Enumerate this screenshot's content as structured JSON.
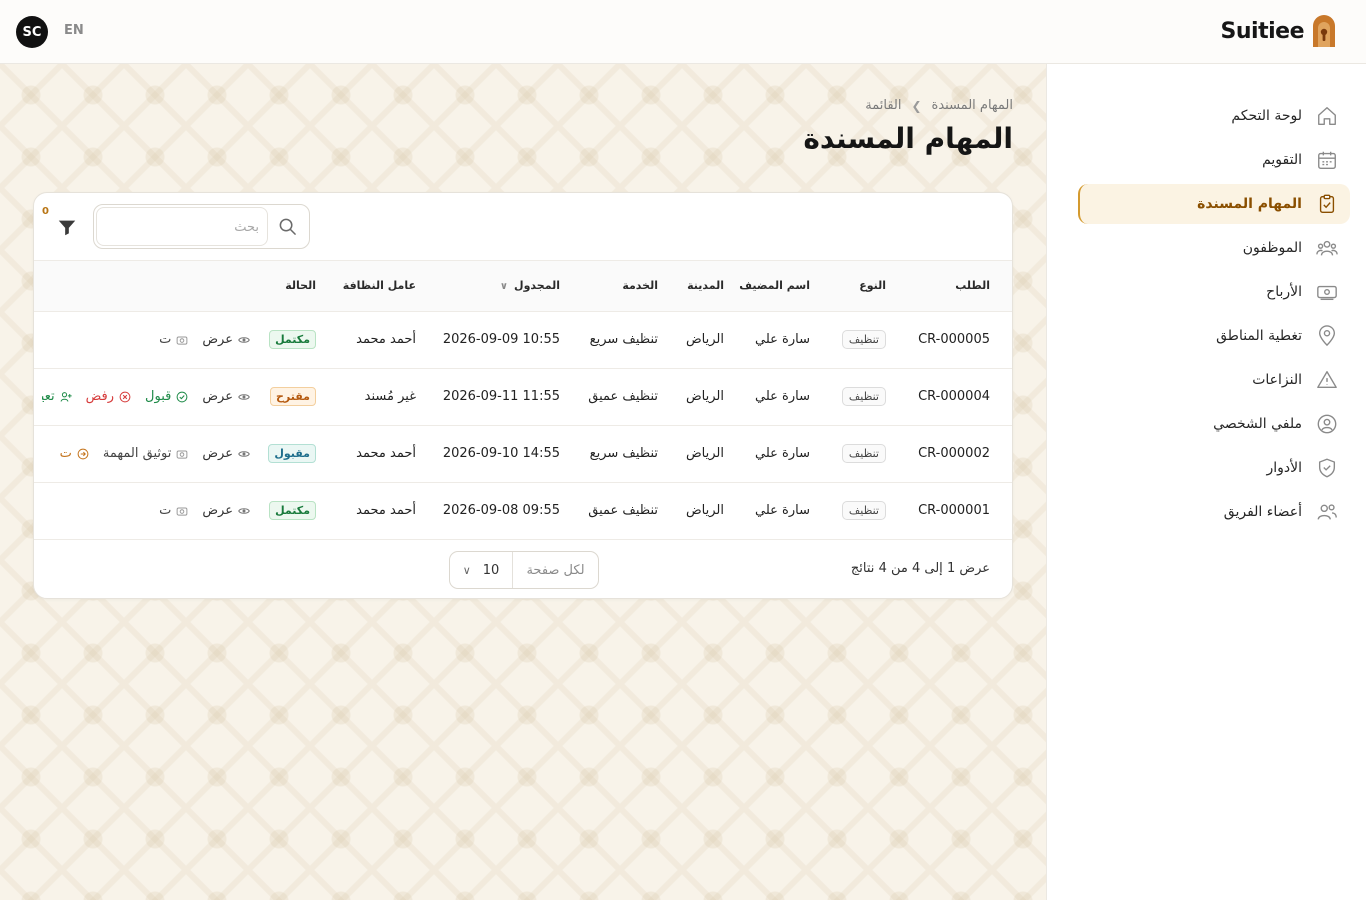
{
  "topbar": {
    "avatar_initials": "SC",
    "language": "EN",
    "brand_name": "Suitiee",
    "brand_color": "#c8782a"
  },
  "breadcrumb": {
    "parent": "المهام المسندة",
    "current": "القائمة"
  },
  "page": {
    "title": "المهام المسندة"
  },
  "toolbar": {
    "search_placeholder": "بحث",
    "filter_count": "0"
  },
  "table": {
    "headers": {
      "request": "الطلب",
      "type": "النوع",
      "guest_name": "اسم المضيف",
      "city": "المدينة",
      "service": "الخدمة",
      "scheduled": "المجدول",
      "cleaner": "عامل النظافة",
      "status": "الحالة"
    },
    "rows": [
      {
        "id": "CR-000005",
        "type": "تنظيف",
        "guest": "سارة علي",
        "city": "الرياض",
        "service": "تنظيف سريع",
        "scheduled": "2026-09-09 10:55",
        "cleaner": "أحمد محمد",
        "status": "مكتمل",
        "actions": {
          "view": "عرض",
          "extra": "ت"
        }
      },
      {
        "id": "CR-000004",
        "type": "تنظيف",
        "guest": "سارة علي",
        "city": "الرياض",
        "service": "تنظيف عميق",
        "scheduled": "2026-09-11 11:55",
        "cleaner": "غير مُسند",
        "status": "مقترح",
        "actions": {
          "view": "عرض",
          "accept": "قبول",
          "reject": "رفض",
          "assign": "تعيين"
        }
      },
      {
        "id": "CR-000002",
        "type": "تنظيف",
        "guest": "سارة علي",
        "city": "الرياض",
        "service": "تنظيف سريع",
        "scheduled": "2026-09-10 14:55",
        "cleaner": "أحمد محمد",
        "status": "مقبول",
        "actions": {
          "view": "عرض",
          "document": "توثيق المهمة",
          "extra": "ت"
        }
      },
      {
        "id": "CR-000001",
        "type": "تنظيف",
        "guest": "سارة علي",
        "city": "الرياض",
        "service": "تنظيف عميق",
        "scheduled": "2026-09-08 09:55",
        "cleaner": "أحمد محمد",
        "status": "مكتمل",
        "actions": {
          "view": "عرض",
          "extra": "ت"
        }
      }
    ]
  },
  "footer": {
    "summary": "عرض 1 إلى 4 من 4 نتائج",
    "per_page_label": "لكل صفحة",
    "per_page_value": "10"
  },
  "sidebar": {
    "items": [
      {
        "label": "لوحة التحكم",
        "icon": "home-icon"
      },
      {
        "label": "التقويم",
        "icon": "calendar-icon"
      },
      {
        "label": "المهام المسندة",
        "icon": "clipboard-check-icon",
        "active": true
      },
      {
        "label": "الموظفون",
        "icon": "users-icon"
      },
      {
        "label": "الأرباح",
        "icon": "banknote-icon"
      },
      {
        "label": "تغطية المناطق",
        "icon": "map-pin-icon"
      },
      {
        "label": "النزاعات",
        "icon": "alert-triangle-icon"
      },
      {
        "label": "ملفي الشخصي",
        "icon": "user-circle-icon"
      },
      {
        "label": "الأدوار",
        "icon": "shield-check-icon"
      },
      {
        "label": "أعضاء الفريق",
        "icon": "team-icon"
      }
    ],
    "active_color": "#d49a2f"
  }
}
